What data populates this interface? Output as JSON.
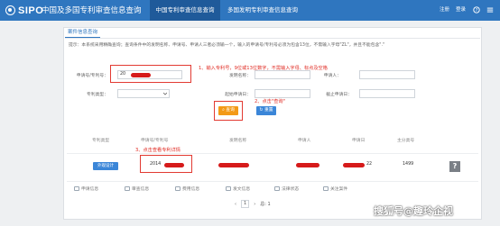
{
  "header": {
    "logo_text": "SIPO",
    "site_title": "中国及多国专利审查信息查询",
    "tabs": [
      {
        "label": "中国专利审查信息查询",
        "active": true
      },
      {
        "label": "多国发明专利审查信息查询",
        "active": false
      }
    ],
    "right_links": [
      "注册",
      "登录"
    ],
    "icons": [
      "help-icon",
      "menu-icon"
    ]
  },
  "panel": {
    "tab_label": "案件信息查询",
    "hint": "提示：本系统采用精确查询；查询条件中的发明名称、申请号、申请人三者必须输一个，输入的申请号/专利号必须为包含13位，不需输入字母\"ZL\"，并且不能包含\".\""
  },
  "form": {
    "row1": {
      "app_no_label": "申请号/专利号：",
      "app_no_value": "20",
      "invention_label": "发明名称：",
      "invention_value": "",
      "applicant_label": "申请人：",
      "applicant_value": ""
    },
    "row2": {
      "type_label": "专利类型：",
      "type_value": "",
      "start_date_label": "起始申请日：",
      "start_date_value": "",
      "end_date_label": "截止申请日：",
      "end_date_value": ""
    },
    "search_label": "查询",
    "reset_label": "重置"
  },
  "annotations": {
    "step1": "1、输入专利号，9位或13位数字，不需输入字母、标点及空格",
    "step2": "2、点击\"查询\"",
    "step3": "3、点击查看专利详情"
  },
  "table": {
    "headers": [
      "专利类型",
      "申请号/专利号",
      "发明名称",
      "申请人",
      "申请日",
      "主分类号"
    ],
    "row": {
      "type": "外观设计",
      "app_no": "2014",
      "date_suffix": "22",
      "class_no": "1499"
    }
  },
  "actions": [
    "申请信息",
    "审查信息",
    "费用信息",
    "发文信息",
    "法律状态",
    "关注案件"
  ],
  "pager": {
    "prev": "‹",
    "current": "1",
    "next": "›",
    "total_label": "总: 1"
  },
  "help_label": "?",
  "watermark": "搜狐号@趣玲企视",
  "colors": {
    "header_blue": "#2f76bf",
    "annotation_red": "#e23a32",
    "search_orange": "#f39a17",
    "reset_blue": "#3b86d8"
  }
}
